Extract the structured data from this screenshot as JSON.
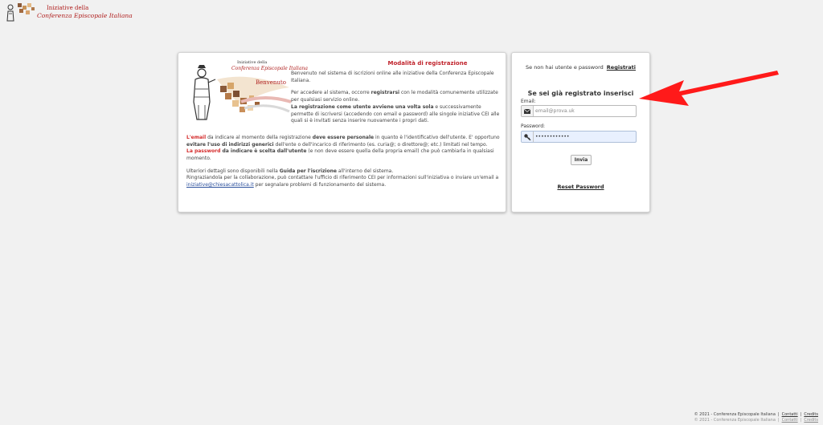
{
  "header": {
    "logo_line1": "Iniziative della",
    "logo_line2": "Conferenza Episcopale Italiana"
  },
  "illustration": {
    "line1": "Iniziative della",
    "line2": "Conferenza Episcopale Italiana",
    "line3": "Benvenuto"
  },
  "info": {
    "title": "Modalità di registrazione",
    "p1": "Benvenuto nel sistema di iscrizioni online alle iniziative della Conferenza Episcopale Italiana.",
    "p2a": "Per accedere al sistema, occorre ",
    "p2b": "registrarsi",
    "p2c": " con le modalità comunemente utilizzate per qualsiasi servizio online.",
    "p3a": "La registrazione come utente avviene una volta sola",
    "p3b": " e successivamente permette di iscriversi (accedendo con email e password) alle singole iniziative CEI alle quali si è invitati senza inserire nuovamente i propri dati.",
    "p4a": "L'email",
    "p4b": " da indicare al momento della registrazione ",
    "p4c": "deve essere personale",
    "p4d": " in quanto è l'identificativo dell'utente. E' opportuno ",
    "p4e": "evitare l'uso di indirizzi generici",
    "p4f": " dell'ente o dell'incarico di riferimento (es. curia@; o direttore@; etc.) limitati nel tempo.",
    "p5a": "La password",
    "p5b": " da indicare è scelta dall'utente",
    "p5c": " (e non deve essere quella della propria email) che può cambiarla in qualsiasi momento.",
    "p6a": "Ulteriori dettagli sono disponibili nella ",
    "p6b": "Guida per l'iscrizione",
    "p6c": " all'interno del sistema.",
    "p7a": "Ringraziandola per la collaborazione, può contattare l'ufficio di riferimento CEI per informazioni sull'iniziativa o inviare un'email a ",
    "p7_email": "iniziative@chiesacattolica.it",
    "p7b": " per segnalare problemi di funzionamento del sistema."
  },
  "login": {
    "no_user_text": "Se non hai utente e password",
    "register_link": "Registrati",
    "title": "Se sei già registrato inserisci",
    "email_label": "Email:",
    "email_placeholder": "email@prova.uk",
    "password_label": "Password:",
    "password_value": "••••••••••••",
    "submit_label": "Invia",
    "reset_link": "Reset Password"
  },
  "footer": {
    "copyright": "© 2021 - Conferenza Episcopale Italiana",
    "contacts": "Contatti",
    "credits": "Credits"
  },
  "icons": {
    "email": "envelope-icon",
    "password": "key-icon",
    "annotation": "red-arrow-icon"
  },
  "colors": {
    "accent_red": "#c0232c",
    "arrow_red": "#ff1a1a",
    "link_blue": "#2a4f9c",
    "background": "#f1f1f1"
  }
}
